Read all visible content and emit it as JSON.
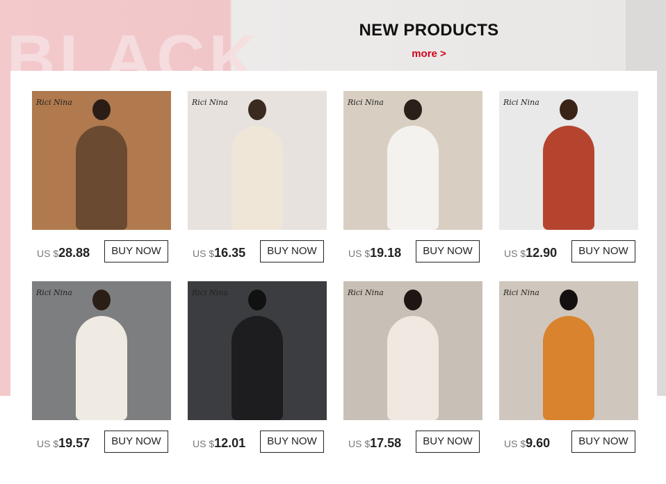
{
  "banner": {
    "background_word": "BLACK"
  },
  "section": {
    "title": "NEW PRODUCTS",
    "more_link": "more >"
  },
  "currency_prefix": "US $",
  "buy_label": "BUY NOW",
  "watermark": "Rici Nina",
  "products": [
    {
      "price": "28.88",
      "bg": "#b07a4e",
      "dress": "#6b4a32",
      "head": "#2b1d15"
    },
    {
      "price": "16.35",
      "bg": "#e7e2de",
      "dress": "#efe6d8",
      "head": "#3a2a20"
    },
    {
      "price": "19.18",
      "bg": "#d8cfc2",
      "dress": "#f4f2ee",
      "head": "#2a201a"
    },
    {
      "price": "12.90",
      "bg": "#e9e9ea",
      "dress": "#b5442f",
      "head": "#3a2418"
    },
    {
      "price": "19.57",
      "bg": "#7d7e7f",
      "dress": "#efeae2",
      "head": "#2a1e16"
    },
    {
      "price": "12.01",
      "bg": "#3b3d40",
      "dress": "#1d1d1f",
      "head": "#111111"
    },
    {
      "price": "17.58",
      "bg": "#c8c0b6",
      "dress": "#efe9e1",
      "head": "#1e1612"
    },
    {
      "price": "9.60",
      "bg": "#cfc7bd",
      "dress": "#d9832f",
      "head": "#141010"
    }
  ]
}
